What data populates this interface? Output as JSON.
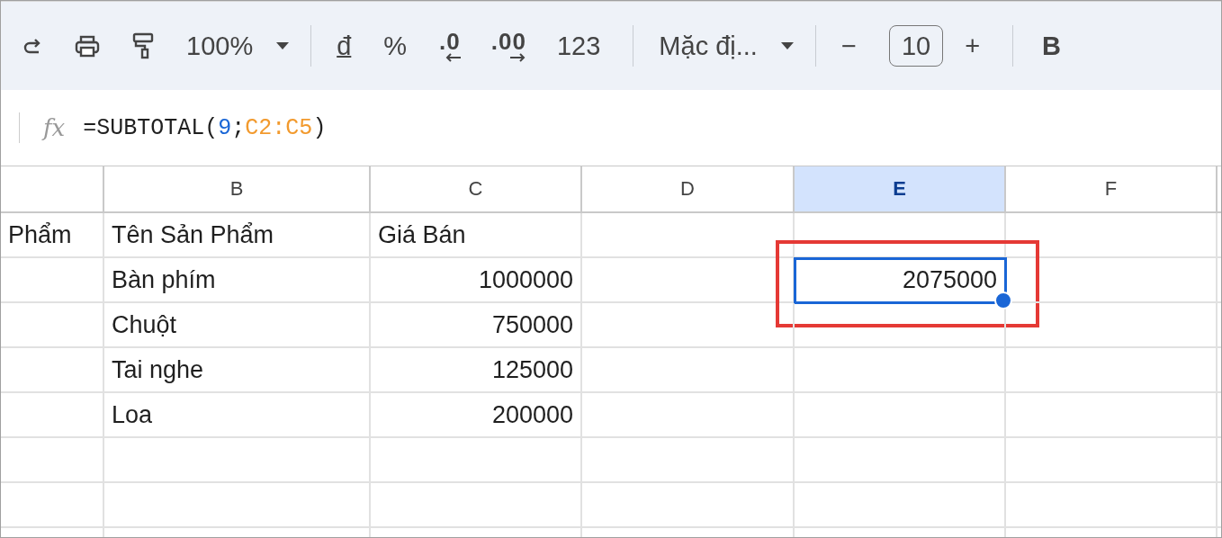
{
  "toolbar": {
    "items": [
      {
        "kind": "redo"
      },
      {
        "kind": "print"
      },
      {
        "kind": "paint-format"
      },
      {
        "kind": "dropdown",
        "label": "100%"
      },
      {
        "kind": "divider"
      },
      {
        "kind": "currency",
        "label": "đ"
      },
      {
        "kind": "text",
        "label": "%"
      },
      {
        "kind": "decimal-less",
        "label": ".0"
      },
      {
        "kind": "decimal-more",
        "label": ".00"
      },
      {
        "kind": "text",
        "label": "123"
      },
      {
        "kind": "divider"
      },
      {
        "kind": "dropdown",
        "label": "Mặc đị..."
      },
      {
        "kind": "divider"
      },
      {
        "kind": "text",
        "label": "−"
      },
      {
        "kind": "field",
        "value": "10"
      },
      {
        "kind": "text",
        "label": "+"
      },
      {
        "kind": "divider"
      },
      {
        "kind": "bold",
        "label": "B"
      }
    ]
  },
  "formula_bar": {
    "icon_label": "fx",
    "tokens": [
      {
        "text": "=SUBTOTAL(",
        "color": "#1f1f1f"
      },
      {
        "text": "9",
        "color": "#1a66d6"
      },
      {
        "text": ";",
        "color": "#1f1f1f"
      },
      {
        "text": "C2:C5",
        "color": "#f29a2e"
      },
      {
        "text": ")",
        "color": "#1f1f1f"
      }
    ]
  },
  "sheet": {
    "columns": [
      {
        "selected": false
      },
      {
        "label": "B",
        "selected": false
      },
      {
        "label": "C",
        "selected": false
      },
      {
        "label": "D",
        "selected": false
      },
      {
        "label": "E",
        "selected": true
      },
      {
        "label": "F",
        "selected": false
      }
    ],
    "rows": [
      [
        {
          "text": "Phẩm",
          "kind": "text",
          "selected": false
        },
        {
          "text": "Tên Sản Phẩm",
          "kind": "text",
          "selected": false
        },
        {
          "text": "Giá Bán",
          "kind": "text",
          "selected": false
        },
        null,
        null,
        null
      ],
      [
        null,
        {
          "text": "Bàn phím",
          "kind": "text",
          "selected": false
        },
        {
          "text": "1000000",
          "kind": "number",
          "selected": false
        },
        null,
        {
          "text": "2075000",
          "kind": "number",
          "selected": true,
          "annotated": true
        },
        null
      ],
      [
        null,
        {
          "text": "Chuột",
          "kind": "text",
          "selected": false
        },
        {
          "text": "750000",
          "kind": "number",
          "selected": false
        },
        null,
        null,
        null
      ],
      [
        null,
        {
          "text": "Tai nghe",
          "kind": "text",
          "selected": false
        },
        {
          "text": "125000",
          "kind": "number",
          "selected": false
        },
        null,
        null,
        null
      ],
      [
        null,
        {
          "text": "Loa",
          "kind": "text",
          "selected": false
        },
        {
          "text": "200000",
          "kind": "number",
          "selected": false
        },
        null,
        null,
        null
      ],
      [
        null,
        null,
        null,
        null,
        null,
        null
      ],
      [
        null,
        null,
        null,
        null,
        null,
        null
      ],
      [
        null,
        null,
        null,
        null,
        null,
        null
      ]
    ]
  }
}
